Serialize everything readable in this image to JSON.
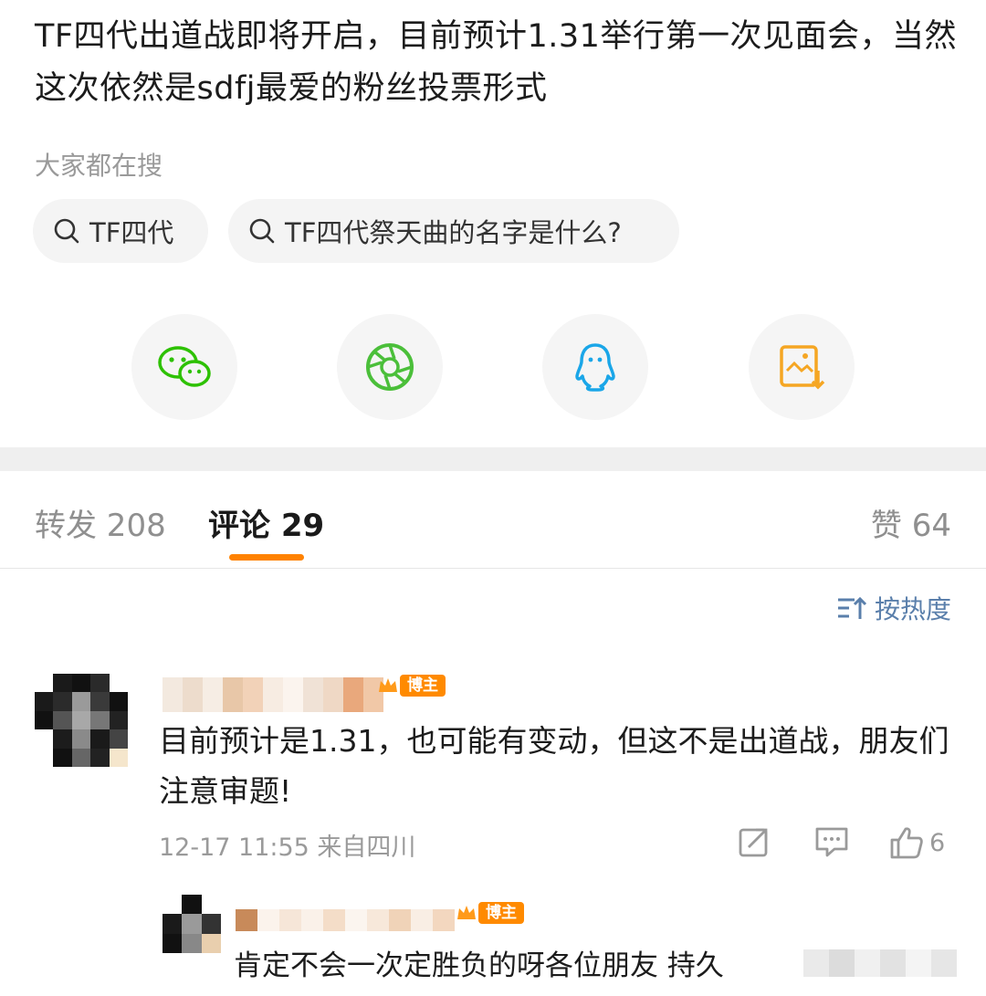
{
  "post": {
    "text": "TF四代出道战即将开启，目前预计1.31举行第一次见面会，当然这次依然是sdfj最爱的粉丝投票形式"
  },
  "search": {
    "label": "大家都在搜",
    "chips": [
      "TF四代",
      "TF四代祭天曲的名字是什么?"
    ]
  },
  "share": {
    "icons": [
      "wechat-icon",
      "moments-icon",
      "qq-icon",
      "save-image-icon"
    ],
    "colors": {
      "wechat": "#2dc100",
      "moments": "#4bbf3a",
      "qq": "#1aa6e8",
      "save": "#f5a623"
    }
  },
  "tabs": {
    "repost": "转发 208",
    "comments": "评论 29",
    "likes": "赞 64"
  },
  "sort": {
    "label": "按热度"
  },
  "comments": [
    {
      "badge": "博主",
      "text": "目前预计是1.31，也可能有变动，但这不是出道战，朋友们注意审题!",
      "time": "12-17 11:55 来自四川",
      "likes": "6"
    }
  ],
  "reply": {
    "badge": "博主",
    "text": "肯定不会一次定胜负的呀各位朋友 持久"
  },
  "accent": "#ff8200",
  "badge_color": "#ff8a00",
  "link_color": "#5a7fab"
}
